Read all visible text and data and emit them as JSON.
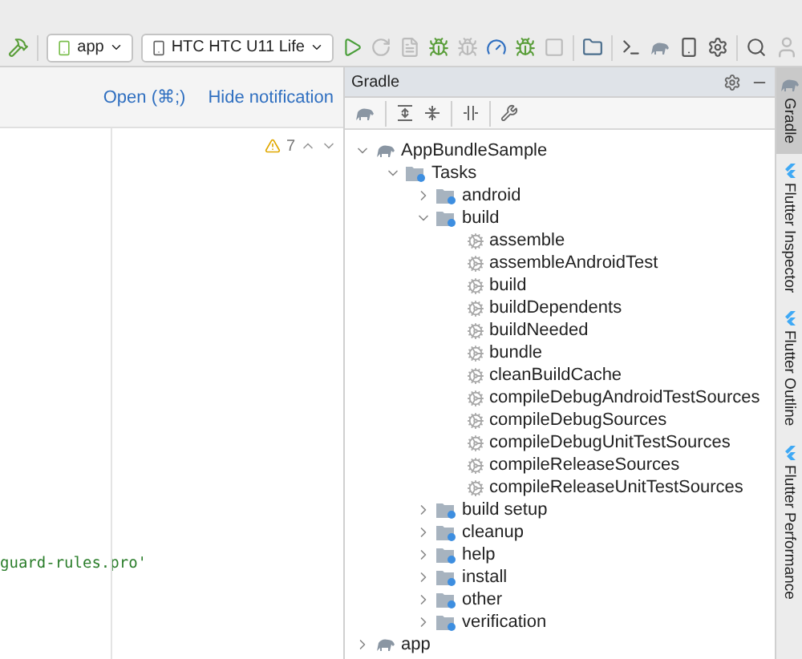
{
  "toolbar": {
    "config": "app",
    "device": "HTC HTC U11 Life"
  },
  "notification": {
    "links": [
      "Open (⌘;)",
      "Hide notification"
    ]
  },
  "editor": {
    "warnings": "7",
    "code_line": "guard-rules.pro'"
  },
  "gradle": {
    "title": "Gradle",
    "tree": [
      {
        "label": "AppBundleSample",
        "kind": "project",
        "expanded": true,
        "children": [
          {
            "label": "Tasks",
            "kind": "folder",
            "expanded": true,
            "children": [
              {
                "label": "android",
                "kind": "folder",
                "expanded": false
              },
              {
                "label": "build",
                "kind": "folder",
                "expanded": true,
                "children": [
                  {
                    "label": "assemble",
                    "kind": "task"
                  },
                  {
                    "label": "assembleAndroidTest",
                    "kind": "task"
                  },
                  {
                    "label": "build",
                    "kind": "task"
                  },
                  {
                    "label": "buildDependents",
                    "kind": "task"
                  },
                  {
                    "label": "buildNeeded",
                    "kind": "task"
                  },
                  {
                    "label": "bundle",
                    "kind": "task"
                  },
                  {
                    "label": "cleanBuildCache",
                    "kind": "task"
                  },
                  {
                    "label": "compileDebugAndroidTestSources",
                    "kind": "task"
                  },
                  {
                    "label": "compileDebugSources",
                    "kind": "task"
                  },
                  {
                    "label": "compileDebugUnitTestSources",
                    "kind": "task"
                  },
                  {
                    "label": "compileReleaseSources",
                    "kind": "task"
                  },
                  {
                    "label": "compileReleaseUnitTestSources",
                    "kind": "task"
                  }
                ]
              },
              {
                "label": "build setup",
                "kind": "folder",
                "expanded": false
              },
              {
                "label": "cleanup",
                "kind": "folder",
                "expanded": false
              },
              {
                "label": "help",
                "kind": "folder",
                "expanded": false
              },
              {
                "label": "install",
                "kind": "folder",
                "expanded": false
              },
              {
                "label": "other",
                "kind": "folder",
                "expanded": false
              },
              {
                "label": "verification",
                "kind": "folder",
                "expanded": false
              }
            ]
          }
        ]
      },
      {
        "label": "app",
        "kind": "project",
        "expanded": false
      }
    ]
  },
  "side_tabs": [
    {
      "label": "Gradle",
      "kind": "gradle",
      "selected": true
    },
    {
      "label": "Flutter Inspector",
      "kind": "flutter",
      "selected": false
    },
    {
      "label": "Flutter Outline",
      "kind": "flutter",
      "selected": false
    },
    {
      "label": "Flutter Performance",
      "kind": "flutter",
      "selected": false
    }
  ]
}
